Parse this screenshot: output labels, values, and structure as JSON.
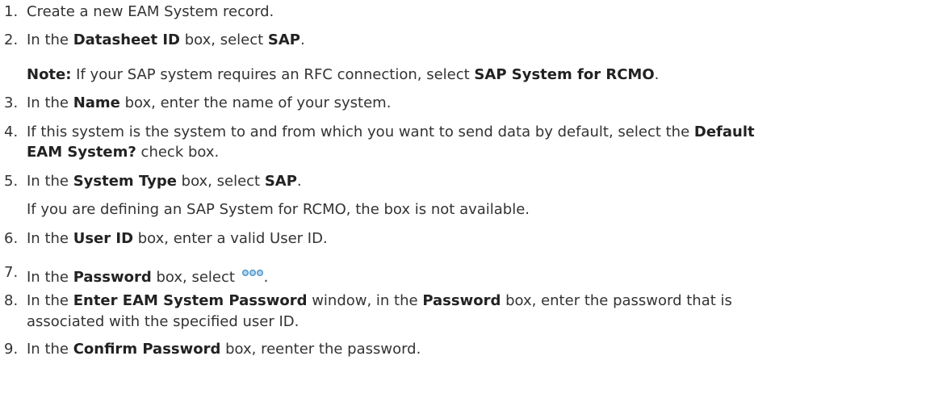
{
  "steps": [
    {
      "number": "1.",
      "text": "Create a new EAM System record."
    },
    {
      "number": "2.",
      "pre": "In the ",
      "b1": "Datasheet ID",
      "mid": " box, select ",
      "b2": "SAP",
      "post": ".",
      "note_label": "Note:",
      "note_text": " If your SAP system requires an RFC connection, select ",
      "note_bold": "SAP System for RCMO",
      "note_post": "."
    },
    {
      "number": "3.",
      "pre": "In the ",
      "b1": "Name",
      "post": " box, enter the name of your system."
    },
    {
      "number": "4.",
      "pre": "If this system is the system to and from which you want to send data by default, select the ",
      "b1": "Default",
      "b2": "EAM System?",
      "post": " check box."
    },
    {
      "number": "5.",
      "pre": "In the ",
      "b1": "System Type",
      "mid": " box, select ",
      "b2": "SAP",
      "post": ".",
      "info": "If you are defining an SAP System for RCMO, the box is not available."
    },
    {
      "number": "6.",
      "pre": "In the ",
      "b1": "User ID",
      "post": " box, enter a valid User ID."
    },
    {
      "number": "7.",
      "pre": "In the ",
      "b1": "Password",
      "mid": " box, select ",
      "icon": "ellipsis-button-icon",
      "post": "."
    },
    {
      "number": "8.",
      "pre": "In the ",
      "b1": "Enter EAM System Password",
      "mid": " window, in the ",
      "b2": "Password",
      "post": " box, enter the password that is",
      "line2": "associated with the specified user ID."
    },
    {
      "number": "9.",
      "pre": "In the ",
      "b1": "Confirm Password",
      "post": " box, reenter the password."
    }
  ],
  "colors": {
    "text": "#333333",
    "icon_fill": "#b3d9f2",
    "icon_stroke": "#4a90c4"
  }
}
